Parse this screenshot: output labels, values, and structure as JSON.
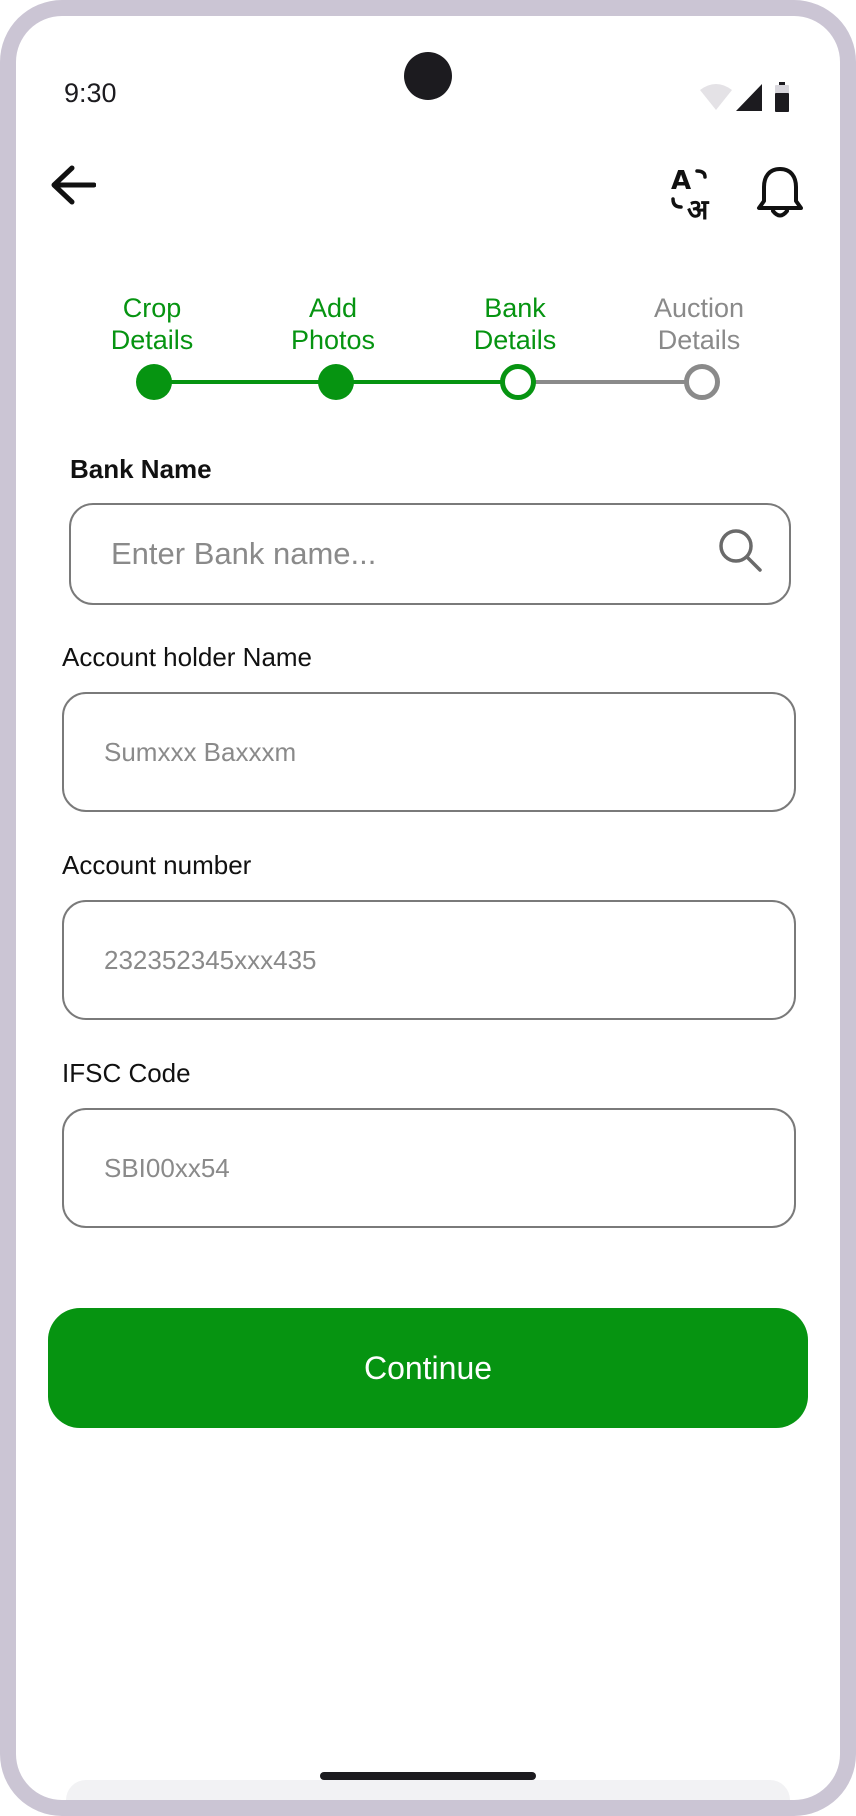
{
  "status_bar": {
    "time": "9:30"
  },
  "top_bar": {
    "back_icon": "arrow-left-icon",
    "translate_icon": "translate-icon",
    "notification_icon": "bell-icon"
  },
  "stepper": {
    "steps": [
      {
        "label_line1": "Crop",
        "label_line2": "Details",
        "state": "completed"
      },
      {
        "label_line1": "Add",
        "label_line2": "Photos",
        "state": "completed"
      },
      {
        "label_line1": "Bank",
        "label_line2": "Details",
        "state": "current"
      },
      {
        "label_line1": "Auction",
        "label_line2": "Details",
        "state": "pending"
      }
    ]
  },
  "form": {
    "bank_name": {
      "label": "Bank Name",
      "placeholder": "Enter Bank name...",
      "value": ""
    },
    "account_holder": {
      "label": "Account holder Name",
      "placeholder": "Sumxxx Baxxxm",
      "value": ""
    },
    "account_number": {
      "label": "Account number",
      "placeholder": "232352345xxx435",
      "value": ""
    },
    "ifsc": {
      "label": "IFSC Code",
      "placeholder": "SBI00xx54",
      "value": ""
    }
  },
  "continue_label": "Continue",
  "colors": {
    "primary": "#069411",
    "inactive": "#8a8a8a",
    "frame": "#cbc5d4"
  }
}
